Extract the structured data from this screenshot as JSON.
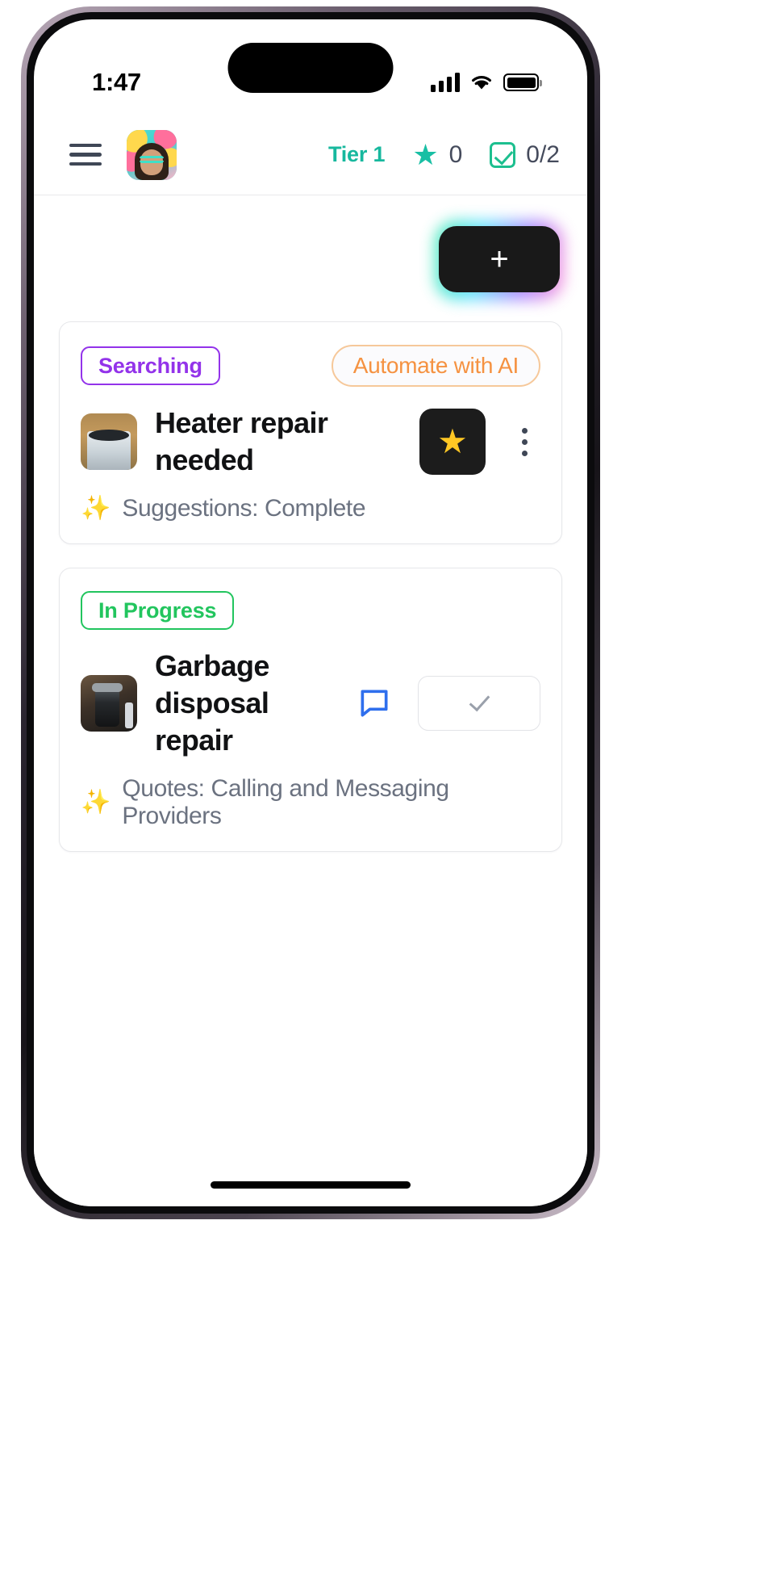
{
  "status_bar": {
    "time": "1:47",
    "signal_icon": "cellular-signal-icon",
    "wifi_icon": "wifi-icon",
    "battery_icon": "battery-icon"
  },
  "header": {
    "menu_icon": "hamburger-menu-icon",
    "avatar_icon": "user-avatar",
    "tier_label": "Tier 1",
    "star_icon": "star-icon",
    "star_count": "0",
    "checkbox_icon": "checkbox-check-icon",
    "task_count": "0/2",
    "tier_color": "#17b89e",
    "star_color": "#19bfa4",
    "check_color": "#1dbf8f"
  },
  "fab": {
    "label": "+",
    "name": "add-task-button"
  },
  "cards": [
    {
      "status_badge": "Searching",
      "status_color": "#9333ea",
      "action_pill": "Automate with AI",
      "action_pill_color": "#f59241",
      "thumbnail": "heater-unit-thumbnail",
      "title": "Heater repair needed",
      "star_button_icon": "star-filled-icon",
      "star_button_color": "#ffc724",
      "menu_icon": "kebab-menu-icon",
      "footer_icon": "sparkles-icon",
      "footer_text": "Suggestions: Complete"
    },
    {
      "status_badge": "In Progress",
      "status_color": "#22c55e",
      "thumbnail": "garbage-disposal-thumbnail",
      "title": "Garbage disposal repair",
      "chat_icon": "chat-bubble-icon",
      "chat_icon_color": "#2f6fed",
      "complete_button_icon": "checkmark-icon",
      "footer_icon": "sparkles-icon",
      "footer_text": "Quotes: Calling and Messaging Providers"
    }
  ]
}
